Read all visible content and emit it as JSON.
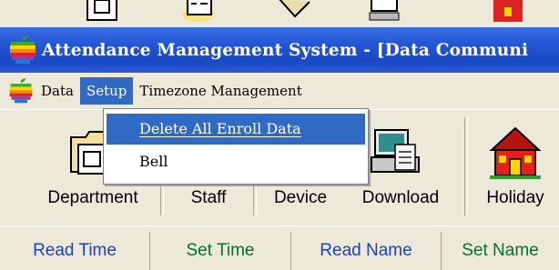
{
  "window": {
    "title": "Attendance Management System - [Data Communi"
  },
  "menubar": {
    "items": [
      {
        "label": "Data",
        "active": false
      },
      {
        "label": "Setup",
        "active": true
      },
      {
        "label": "Timezone Management",
        "active": false
      }
    ]
  },
  "dropdown": {
    "items": [
      {
        "label": "Delete All Enroll Data",
        "highlighted": true,
        "mnemonic": "D"
      },
      {
        "label": "Bell",
        "highlighted": false,
        "mnemonic": "B"
      }
    ]
  },
  "toolbar": {
    "buttons": [
      {
        "label": "Department",
        "icon": "department-icon"
      },
      {
        "label": "Staff",
        "icon": "staff-icon"
      },
      {
        "label": "Device",
        "icon": "device-icon"
      },
      {
        "label": "Download",
        "icon": "download-icon"
      },
      {
        "label": "Holiday",
        "icon": "holiday-icon"
      }
    ]
  },
  "tabs": [
    {
      "label": "Read Time",
      "color": "#1a3fcc"
    },
    {
      "label": "Set Time",
      "color": "#006f3c"
    },
    {
      "label": "Read Name",
      "color": "#1a3fcc"
    },
    {
      "label": "Set Name",
      "color": "#006f3c"
    }
  ],
  "colors": {
    "titlebar": "#2457d6",
    "menu_highlight": "#316ac5",
    "background": "#ece9d8"
  }
}
